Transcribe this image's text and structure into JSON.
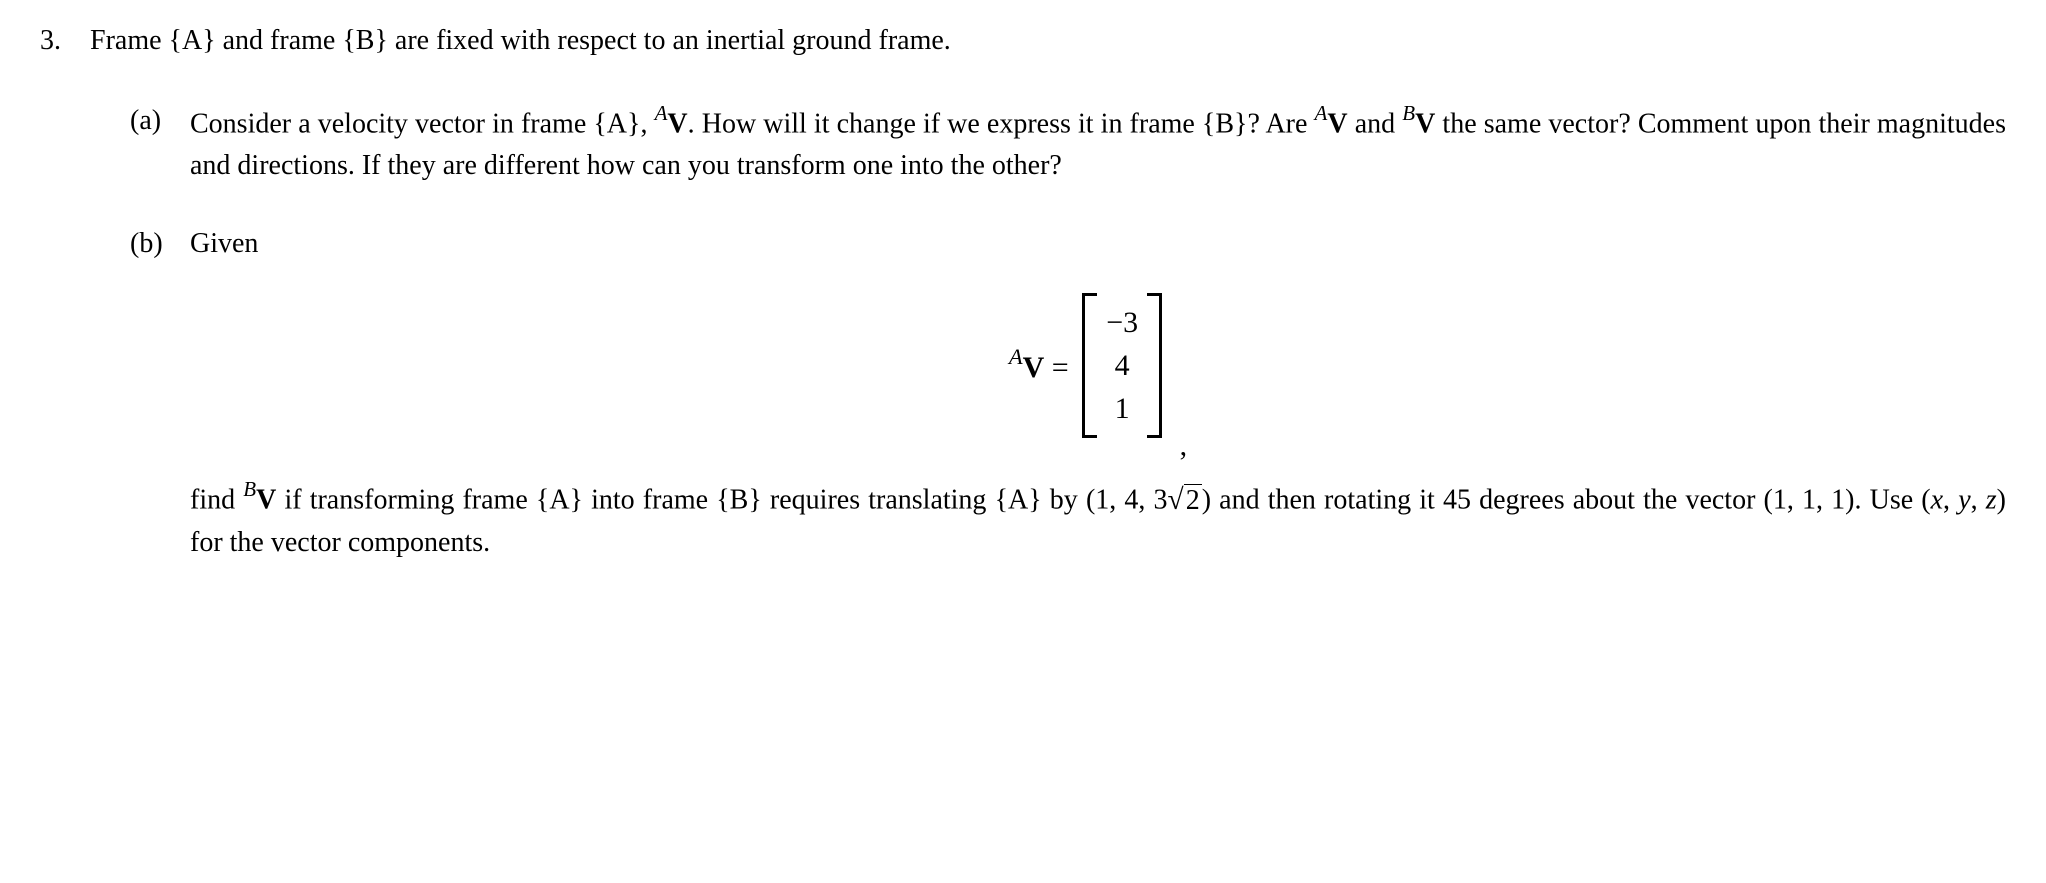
{
  "problem": {
    "number": "3.",
    "statement_parts": {
      "p1": "Frame {A} and frame {B} are fixed with respect to an inertial ground frame."
    },
    "part_a": {
      "label": "(a)",
      "t1": "Consider a velocity vector in frame {A}, ",
      "vA_sup": "A",
      "vA_sym": "V",
      "t2": ".  How will it change if we express it in frame {B}?  Are ",
      "vA2_sup": "A",
      "vA2_sym": "V",
      "t3": " and ",
      "vB_sup": "B",
      "vB_sym": "V",
      "t4": " the same vector?  Comment upon their magnitudes and directions. If they are different how can you transform one into the other?"
    },
    "part_b": {
      "label": "(b)",
      "given": "Given",
      "eq_left_sup": "A",
      "eq_left_sym": "V",
      "eq_eq": " = ",
      "matrix": {
        "r1": "−3",
        "r2": "4",
        "r3": "1"
      },
      "comma": ",",
      "t1": "find ",
      "vB_sup": "B",
      "vB_sym": "V",
      "t2": " if transforming frame {A} into frame {B} requires translating {A} by (1, 4, 3",
      "sqrt_val": "2",
      "t3": ") and then rotating it 45 degrees about the vector (1, 1, 1).  Use (",
      "xyz_x": "x",
      "xyz_c1": ", ",
      "xyz_y": "y",
      "xyz_c2": ", ",
      "xyz_z": "z",
      "t4": ") for the vector components."
    }
  }
}
